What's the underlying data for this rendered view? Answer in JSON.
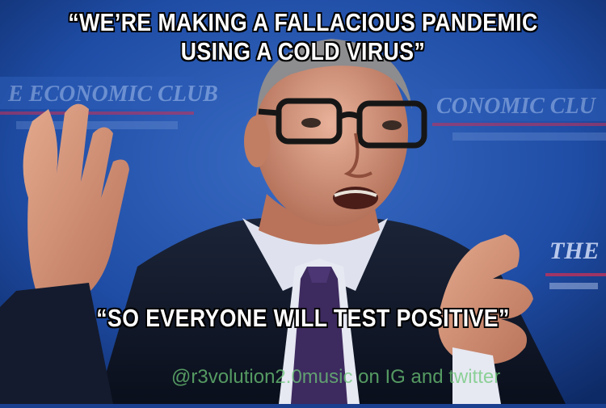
{
  "meme": {
    "top_caption": {
      "line1": "“WE’RE MAKING A FALLACIOUS PANDEMIC",
      "line2": "USING A COLD VIRUS”"
    },
    "bottom_caption": "“SO EVERYONE WILL TEST POSITIVE”",
    "watermark": "@r3volution2.0music on IG and twitter"
  },
  "backdrop": {
    "left_banner": "E ECONOMIC CLUB",
    "right_banner": "CONOMIC CLU",
    "right_sign": "THE"
  },
  "colors": {
    "backdrop_blue": "#1f4da6",
    "caption_text": "#ffffff",
    "watermark_green": "#6ec878"
  }
}
